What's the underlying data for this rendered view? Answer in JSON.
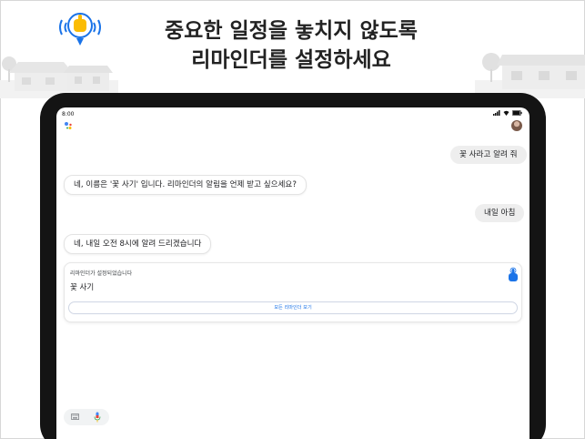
{
  "hero": {
    "line1": "중요한 일정을 놓치지 않도록",
    "line2": "리마인더를 설정하세요"
  },
  "status_bar": {
    "time": "8:00"
  },
  "chat": {
    "messages": [
      {
        "role": "user",
        "text": "꽃 사라고 알려 줘"
      },
      {
        "role": "assistant",
        "text": "네, 이름은 '꽃 사기' 입니다. 리마인더의 알림을 언제 받고 싶으세요?"
      },
      {
        "role": "user",
        "text": "내일 아침"
      },
      {
        "role": "assistant",
        "text": "네, 내일 오전 8시에 알려 드리겠습니다"
      }
    ]
  },
  "reminder_card": {
    "title": "리마인더가 설정되었습니다",
    "reminder_text": "꽃 사기",
    "button_label": "모든 리마인더 보기"
  },
  "colors": {
    "accent_blue": "#1a73e8",
    "bell_yellow": "#fbbc04",
    "bubble_gray": "#eeeeee"
  },
  "icons": {
    "bell": "bell-hand-icon",
    "keyboard": "keyboard-icon",
    "mic": "mic-icon"
  }
}
